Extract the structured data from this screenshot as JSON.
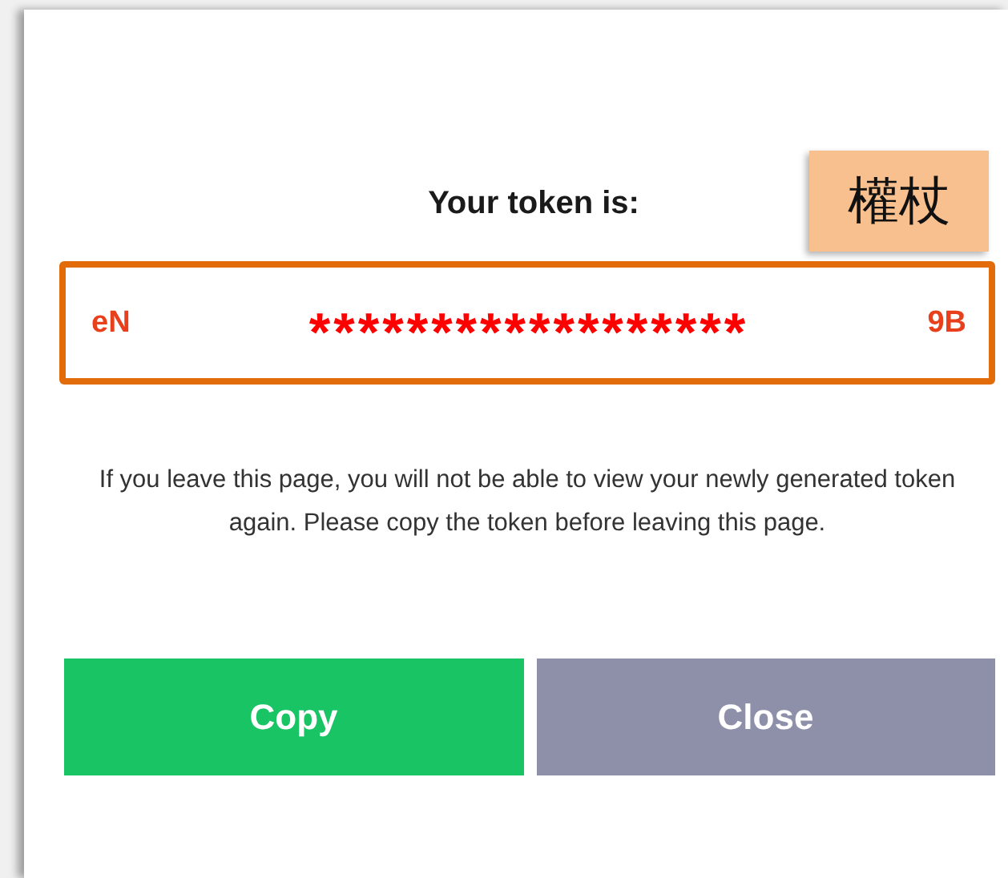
{
  "dialog": {
    "title": "Your token is:",
    "annotation": "權杖",
    "token": {
      "prefix": "eN",
      "masked": "******************",
      "suffix": "9B"
    },
    "message": "If you leave this page, you will not be able to view your newly generated token again. Please copy the token before leaving this page.",
    "buttons": [
      {
        "label": "Copy",
        "kind": "primary"
      },
      {
        "label": "Close",
        "kind": "secondary"
      }
    ]
  }
}
